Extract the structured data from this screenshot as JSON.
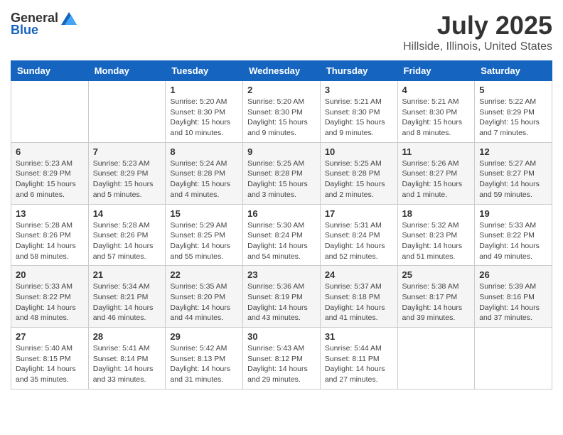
{
  "header": {
    "logo_general": "General",
    "logo_blue": "Blue",
    "month_title": "July 2025",
    "location": "Hillside, Illinois, United States"
  },
  "weekdays": [
    "Sunday",
    "Monday",
    "Tuesday",
    "Wednesday",
    "Thursday",
    "Friday",
    "Saturday"
  ],
  "weeks": [
    [
      {
        "day": "",
        "info": ""
      },
      {
        "day": "",
        "info": ""
      },
      {
        "day": "1",
        "info": "Sunrise: 5:20 AM\nSunset: 8:30 PM\nDaylight: 15 hours and 10 minutes."
      },
      {
        "day": "2",
        "info": "Sunrise: 5:20 AM\nSunset: 8:30 PM\nDaylight: 15 hours and 9 minutes."
      },
      {
        "day": "3",
        "info": "Sunrise: 5:21 AM\nSunset: 8:30 PM\nDaylight: 15 hours and 9 minutes."
      },
      {
        "day": "4",
        "info": "Sunrise: 5:21 AM\nSunset: 8:30 PM\nDaylight: 15 hours and 8 minutes."
      },
      {
        "day": "5",
        "info": "Sunrise: 5:22 AM\nSunset: 8:29 PM\nDaylight: 15 hours and 7 minutes."
      }
    ],
    [
      {
        "day": "6",
        "info": "Sunrise: 5:23 AM\nSunset: 8:29 PM\nDaylight: 15 hours and 6 minutes."
      },
      {
        "day": "7",
        "info": "Sunrise: 5:23 AM\nSunset: 8:29 PM\nDaylight: 15 hours and 5 minutes."
      },
      {
        "day": "8",
        "info": "Sunrise: 5:24 AM\nSunset: 8:28 PM\nDaylight: 15 hours and 4 minutes."
      },
      {
        "day": "9",
        "info": "Sunrise: 5:25 AM\nSunset: 8:28 PM\nDaylight: 15 hours and 3 minutes."
      },
      {
        "day": "10",
        "info": "Sunrise: 5:25 AM\nSunset: 8:28 PM\nDaylight: 15 hours and 2 minutes."
      },
      {
        "day": "11",
        "info": "Sunrise: 5:26 AM\nSunset: 8:27 PM\nDaylight: 15 hours and 1 minute."
      },
      {
        "day": "12",
        "info": "Sunrise: 5:27 AM\nSunset: 8:27 PM\nDaylight: 14 hours and 59 minutes."
      }
    ],
    [
      {
        "day": "13",
        "info": "Sunrise: 5:28 AM\nSunset: 8:26 PM\nDaylight: 14 hours and 58 minutes."
      },
      {
        "day": "14",
        "info": "Sunrise: 5:28 AM\nSunset: 8:26 PM\nDaylight: 14 hours and 57 minutes."
      },
      {
        "day": "15",
        "info": "Sunrise: 5:29 AM\nSunset: 8:25 PM\nDaylight: 14 hours and 55 minutes."
      },
      {
        "day": "16",
        "info": "Sunrise: 5:30 AM\nSunset: 8:24 PM\nDaylight: 14 hours and 54 minutes."
      },
      {
        "day": "17",
        "info": "Sunrise: 5:31 AM\nSunset: 8:24 PM\nDaylight: 14 hours and 52 minutes."
      },
      {
        "day": "18",
        "info": "Sunrise: 5:32 AM\nSunset: 8:23 PM\nDaylight: 14 hours and 51 minutes."
      },
      {
        "day": "19",
        "info": "Sunrise: 5:33 AM\nSunset: 8:22 PM\nDaylight: 14 hours and 49 minutes."
      }
    ],
    [
      {
        "day": "20",
        "info": "Sunrise: 5:33 AM\nSunset: 8:22 PM\nDaylight: 14 hours and 48 minutes."
      },
      {
        "day": "21",
        "info": "Sunrise: 5:34 AM\nSunset: 8:21 PM\nDaylight: 14 hours and 46 minutes."
      },
      {
        "day": "22",
        "info": "Sunrise: 5:35 AM\nSunset: 8:20 PM\nDaylight: 14 hours and 44 minutes."
      },
      {
        "day": "23",
        "info": "Sunrise: 5:36 AM\nSunset: 8:19 PM\nDaylight: 14 hours and 43 minutes."
      },
      {
        "day": "24",
        "info": "Sunrise: 5:37 AM\nSunset: 8:18 PM\nDaylight: 14 hours and 41 minutes."
      },
      {
        "day": "25",
        "info": "Sunrise: 5:38 AM\nSunset: 8:17 PM\nDaylight: 14 hours and 39 minutes."
      },
      {
        "day": "26",
        "info": "Sunrise: 5:39 AM\nSunset: 8:16 PM\nDaylight: 14 hours and 37 minutes."
      }
    ],
    [
      {
        "day": "27",
        "info": "Sunrise: 5:40 AM\nSunset: 8:15 PM\nDaylight: 14 hours and 35 minutes."
      },
      {
        "day": "28",
        "info": "Sunrise: 5:41 AM\nSunset: 8:14 PM\nDaylight: 14 hours and 33 minutes."
      },
      {
        "day": "29",
        "info": "Sunrise: 5:42 AM\nSunset: 8:13 PM\nDaylight: 14 hours and 31 minutes."
      },
      {
        "day": "30",
        "info": "Sunrise: 5:43 AM\nSunset: 8:12 PM\nDaylight: 14 hours and 29 minutes."
      },
      {
        "day": "31",
        "info": "Sunrise: 5:44 AM\nSunset: 8:11 PM\nDaylight: 14 hours and 27 minutes."
      },
      {
        "day": "",
        "info": ""
      },
      {
        "day": "",
        "info": ""
      }
    ]
  ]
}
